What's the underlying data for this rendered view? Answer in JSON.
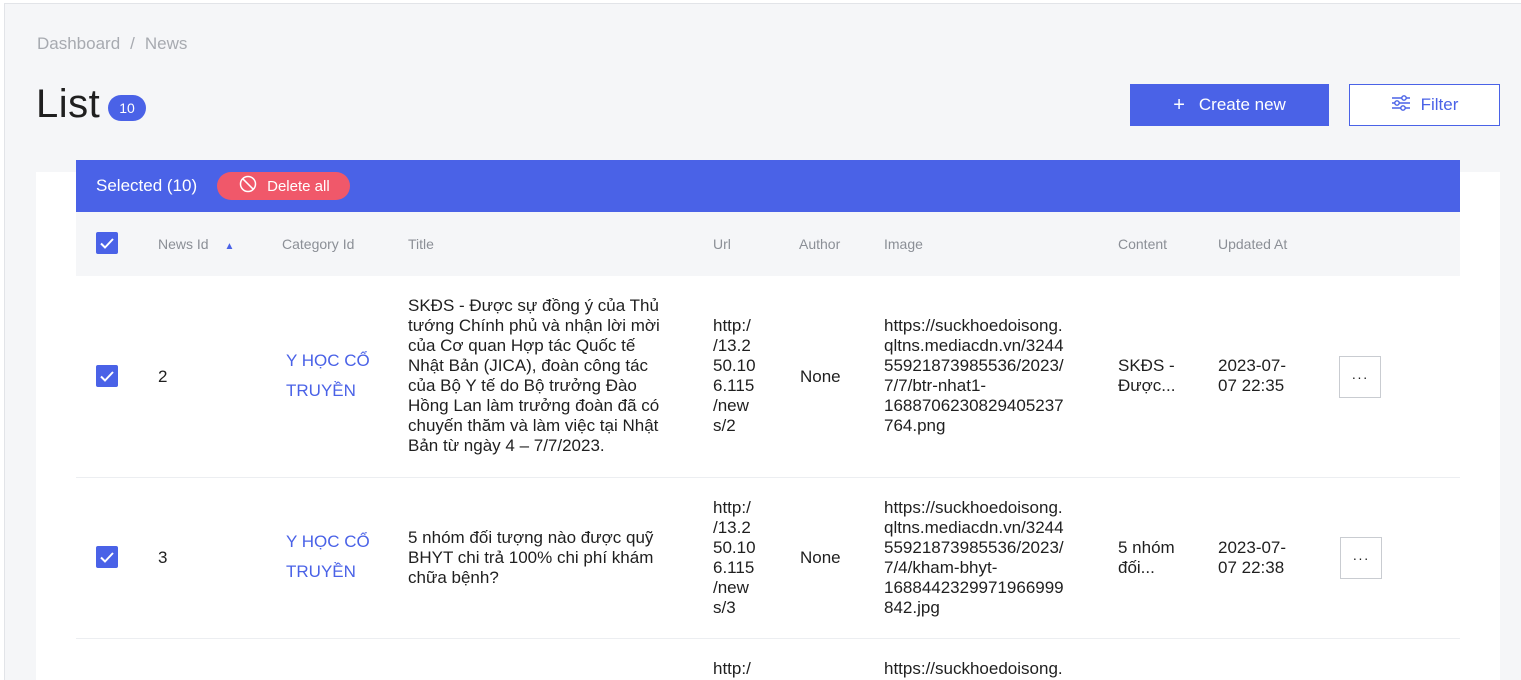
{
  "breadcrumb": {
    "home": "Dashboard",
    "separator": "/",
    "current": "News"
  },
  "header": {
    "title": "List",
    "count": "10",
    "create_label": "Create new",
    "filter_label": "Filter"
  },
  "selection": {
    "selected_label": "Selected (10)",
    "delete_label": "Delete all"
  },
  "table": {
    "columns": {
      "news_id": "News Id",
      "category_id": "Category Id",
      "title": "Title",
      "url": "Url",
      "author": "Author",
      "image": "Image",
      "content": "Content",
      "updated_at": "Updated At"
    },
    "rows": [
      {
        "news_id": "2",
        "category": [
          "Y HỌC CỔ",
          "TRUYỀN"
        ],
        "title": [
          "SKĐS - Được sự đồng ý của Thủ",
          "tướng Chính phủ và nhận lời mời",
          "của Cơ quan Hợp tác Quốc tế",
          "Nhật Bản (JICA), đoàn công tác",
          "của Bộ Y tế do Bộ trưởng Đào",
          "Hồng Lan làm trưởng đoàn đã có",
          "chuyến thăm và làm việc tại Nhật",
          "Bản từ ngày 4 – 7/7/2023."
        ],
        "url": [
          "http:/",
          "/13.2",
          "50.10",
          "6.115",
          "/new",
          "s/2"
        ],
        "author": "None",
        "image": [
          "https://suckhoedoisong.",
          "qltns.mediacdn.vn/3244",
          "55921873985536/2023/",
          "7/7/btr-nhat1-",
          "1688706230829405237",
          "764.png"
        ],
        "content": [
          "SKĐS -",
          "Được..."
        ],
        "updated_at": [
          "2023-07-",
          "07 22:35"
        ],
        "more_label": "···"
      },
      {
        "news_id": "3",
        "category": [
          "Y HỌC CỔ",
          "TRUYỀN"
        ],
        "title": [
          "5 nhóm đối tượng nào được quỹ",
          "BHYT chi trả 100% chi phí khám",
          "chữa bệnh?"
        ],
        "url": [
          "http:/",
          "/13.2",
          "50.10",
          "6.115",
          "/new",
          "s/3"
        ],
        "author": "None",
        "image": [
          "https://suckhoedoisong.",
          "qltns.mediacdn.vn/3244",
          "55921873985536/2023/",
          "7/4/kham-bhyt-",
          "1688442329971966999",
          "842.jpg"
        ],
        "content": [
          "5 nhóm",
          "đối..."
        ],
        "updated_at": [
          "2023-07-",
          "07 22:38"
        ],
        "more_label": "···"
      },
      {
        "url": [
          "http:/"
        ],
        "image": [
          "https://suckhoedoisong."
        ]
      }
    ]
  }
}
